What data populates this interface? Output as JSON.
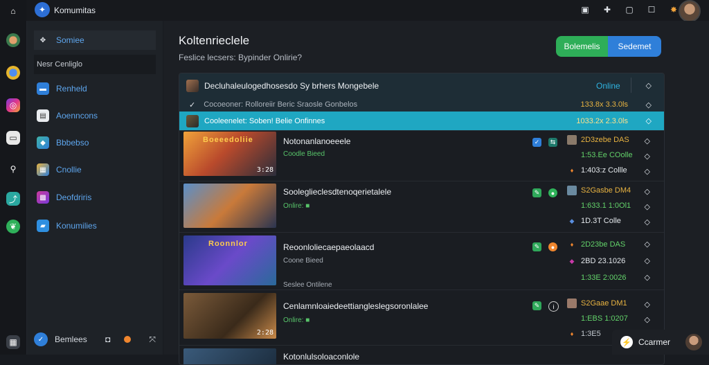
{
  "app": {
    "title": "Komumitas",
    "logo_icon": "gamepad-logo-icon"
  },
  "topbar": {
    "icons": [
      "notes-icon",
      "puzzle-icon",
      "chat-icon",
      "calendar-icon",
      "grid-app-icon"
    ],
    "avatar": "user-avatar"
  },
  "rail": {
    "icons": [
      "home-icon",
      "avatar-app-icon",
      "browser-icon",
      "instagram-icon",
      "message-icon",
      "tools-icon",
      "link-icon",
      "leaf-icon",
      "settings-grid-icon"
    ]
  },
  "sidebar": {
    "items": [
      {
        "label": "Somiee",
        "icon": "friends-icon",
        "active": true
      },
      {
        "label": "Nesr Cenliglo",
        "icon": "",
        "header": true
      },
      {
        "label": "Renheld",
        "icon": "chat-bubble-icon"
      },
      {
        "label": "Aoenncons",
        "icon": "document-icon"
      },
      {
        "label": "Bbbebso",
        "icon": "cube-icon"
      },
      {
        "label": "Cnollie",
        "icon": "image-icon"
      },
      {
        "label": "Deofdriris",
        "icon": "gallery-icon"
      },
      {
        "label": "Konumilies",
        "icon": "folder-icon"
      }
    ],
    "bottom": {
      "label": "Bemlees",
      "icon": "check-circle-icon",
      "extra_icons": [
        "gift-icon",
        "orange-dot-icon",
        "expand-icon"
      ]
    }
  },
  "main": {
    "title": "Koltenrieclele",
    "subtitle": "Feslice lecsers: Bypinder Onlirie?",
    "buttons": {
      "green": "Bolemelis",
      "blue": "Sedemet"
    }
  },
  "panel": {
    "head": {
      "text": "Decluhaleulogedhosesdo Sy brhers Mongebele",
      "status": "Online",
      "chevron": "◇"
    },
    "sub": {
      "text": "Cocoeoner: Rolloreiir Beric  Sraosle Gonbelos",
      "time": "133.8x 3.3.0ls"
    },
    "highlight": {
      "text": "Cooleenelet: Soben! Belie Onfinnes",
      "time": "1033.2x 2.3.0ls"
    },
    "games": [
      {
        "title": "Notonanlanoeeele",
        "sub": "Coodle Bieed",
        "sub2": "",
        "duration": "3:28",
        "thumb_text": "Boeeedoliie",
        "meta": [
          {
            "text": "2D3zebe DAS",
            "tone": "y"
          },
          {
            "text": "1:53.Ee COolle",
            "tone": "g"
          },
          {
            "text": "1:403:z Collle",
            "tone": "w"
          }
        ]
      },
      {
        "title": "Sooleglieclesdtenoqerietalele",
        "sub": "Onlire: ■",
        "sub2": "",
        "duration": "",
        "thumb_text": "",
        "meta": [
          {
            "text": "S2Gasbe DM4",
            "tone": "y"
          },
          {
            "text": "1:633.1 1:0Ol1",
            "tone": "g"
          },
          {
            "text": "1D.3T  Colle",
            "tone": "w"
          }
        ]
      },
      {
        "title": "Reoonloliecaepaeolaacd",
        "sub": "Coone Bieed",
        "sub2": "Seslee Ontilene",
        "duration": "",
        "thumb_text": "Roonnlor",
        "meta": [
          {
            "text": "2D23be DAS",
            "tone": "g"
          },
          {
            "text": "2BD 23.1026",
            "tone": "w"
          },
          {
            "text": "1:33E 2:0026",
            "tone": "g"
          }
        ]
      },
      {
        "title": "Cenlamnloaiedeettiangleslegsoronlalee",
        "sub": "Onlire: ■",
        "sub2": "",
        "duration": "2:28",
        "thumb_text": "",
        "meta": [
          {
            "text": "S2Gaae DM1",
            "tone": "y"
          },
          {
            "text": "1:EBS 1:0207",
            "tone": "g"
          },
          {
            "text": "1:3E5",
            "tone": "muted"
          }
        ]
      },
      {
        "title": "Kotonlulsoloaconlole",
        "sub": "",
        "sub2": "",
        "duration": "",
        "thumb_text": "",
        "meta": []
      }
    ]
  },
  "toast": {
    "label": "Ccarmer",
    "icon": "bolt-icon"
  },
  "colors": {
    "accent_blue": "#2f7fd9",
    "accent_green": "#2eae58",
    "highlight_cyan": "#1fa7c2",
    "bg": "#181b20"
  }
}
